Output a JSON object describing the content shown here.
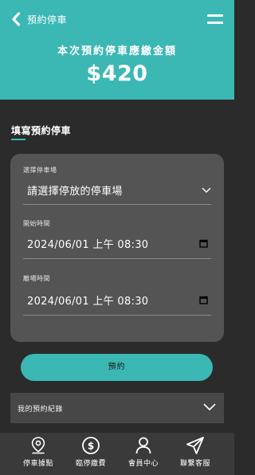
{
  "header": {
    "back_label": "預約停車",
    "fee_title": "本次預約停車應繳金額",
    "fee_amount": "$420"
  },
  "section": {
    "title": "填寫預約停車"
  },
  "form": {
    "lot": {
      "label": "選擇停車場",
      "value": "請選擇停放的停車場"
    },
    "start": {
      "label": "開始時間",
      "value": "2024/06/01 上午 08:30"
    },
    "end": {
      "label": "離場時間",
      "value": "2024/06/01 上午 08:30"
    }
  },
  "reserve_button": {
    "label": "預約"
  },
  "records": {
    "label": "我的預約紀錄"
  },
  "tabs": [
    {
      "label": "停車據點",
      "icon": "location-pin-icon"
    },
    {
      "label": "臨停繳費",
      "icon": "dollar-coin-icon"
    },
    {
      "label": "會員中心",
      "icon": "user-icon"
    },
    {
      "label": "聯繫客服",
      "icon": "send-icon"
    }
  ],
  "colors": {
    "accent": "#3bb7b4",
    "background": "#2b2b2b",
    "card": "#545454"
  }
}
